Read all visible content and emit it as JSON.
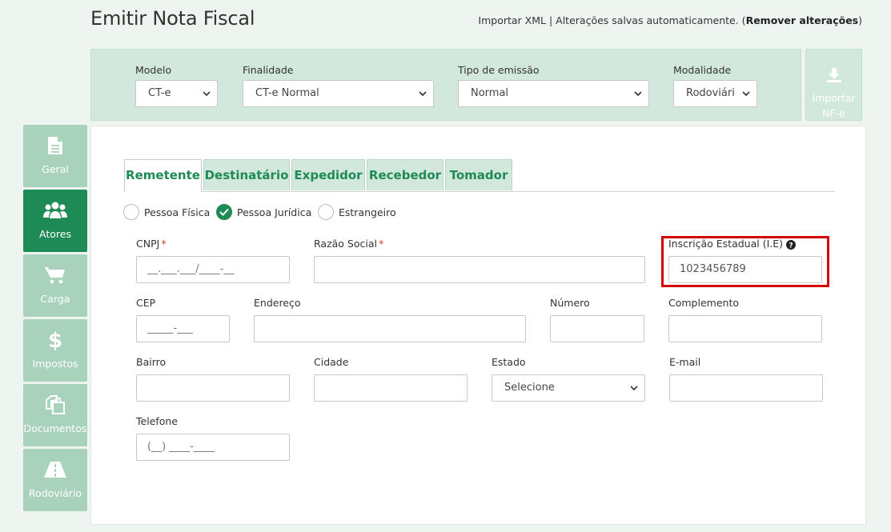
{
  "page": {
    "title": "Emitir Nota Fiscal",
    "import_xml": "Importar XML",
    "separator": "|",
    "autosave": "Alterações salvas automaticamente.",
    "remove_open": "(",
    "remove_label": "Remover alterações",
    "remove_close": ")"
  },
  "topbar": {
    "modelo": {
      "label": "Modelo",
      "value": "CT-e"
    },
    "finalidade": {
      "label": "Finalidade",
      "value": "CT-e Normal"
    },
    "tipo_emissao": {
      "label": "Tipo de emissão",
      "value": "Normal"
    },
    "modalidade": {
      "label": "Modalidade",
      "value": "Rodoviári"
    },
    "import_nfe": {
      "line1": "Importar",
      "line2": "NF-e",
      "icon": "download-icon"
    }
  },
  "sidenav": {
    "items": [
      {
        "label": "Geral",
        "icon": "document-icon",
        "active": false
      },
      {
        "label": "Atores",
        "icon": "users-icon",
        "active": true
      },
      {
        "label": "Carga",
        "icon": "cart-icon",
        "active": false
      },
      {
        "label": "Impostos",
        "icon": "dollar-icon",
        "active": false
      },
      {
        "label": "Documentos",
        "icon": "copy-icon",
        "active": false
      },
      {
        "label": "Rodoviário",
        "icon": "road-icon",
        "active": false
      }
    ]
  },
  "tabs": [
    {
      "label": "Remetente",
      "active": true
    },
    {
      "label": "Destinatário",
      "active": false
    },
    {
      "label": "Expedidor",
      "active": false
    },
    {
      "label": "Recebedor",
      "active": false
    },
    {
      "label": "Tomador",
      "active": false
    }
  ],
  "person_type": {
    "options": [
      "Pessoa Física",
      "Pessoa Jurídica",
      "Estrangeiro"
    ],
    "selected": "Pessoa Jurídica"
  },
  "form": {
    "cnpj": {
      "label": "CNPJ",
      "required": "*",
      "placeholder": "__.___.___/____-__",
      "value": ""
    },
    "razao_social": {
      "label": "Razão Social",
      "required": "*",
      "value": ""
    },
    "ie": {
      "label": "Inscrição Estadual (I.E)",
      "value": "1023456789"
    },
    "cep": {
      "label": "CEP",
      "placeholder": "_____-___",
      "value": ""
    },
    "endereco": {
      "label": "Endereço",
      "value": ""
    },
    "numero": {
      "label": "Número",
      "value": ""
    },
    "complemento": {
      "label": "Complemento",
      "value": ""
    },
    "bairro": {
      "label": "Bairro",
      "value": ""
    },
    "cidade": {
      "label": "Cidade",
      "value": ""
    },
    "estado": {
      "label": "Estado",
      "value": "Selecione"
    },
    "email": {
      "label": "E-mail",
      "value": ""
    },
    "telefone": {
      "label": "Telefone",
      "placeholder": "(__) ____-____",
      "value": ""
    }
  },
  "colors": {
    "accent": "#1e8a56",
    "accent_light": "#a9d2bd",
    "bar_bg": "#d3e8dd",
    "highlight": "#d60000"
  }
}
